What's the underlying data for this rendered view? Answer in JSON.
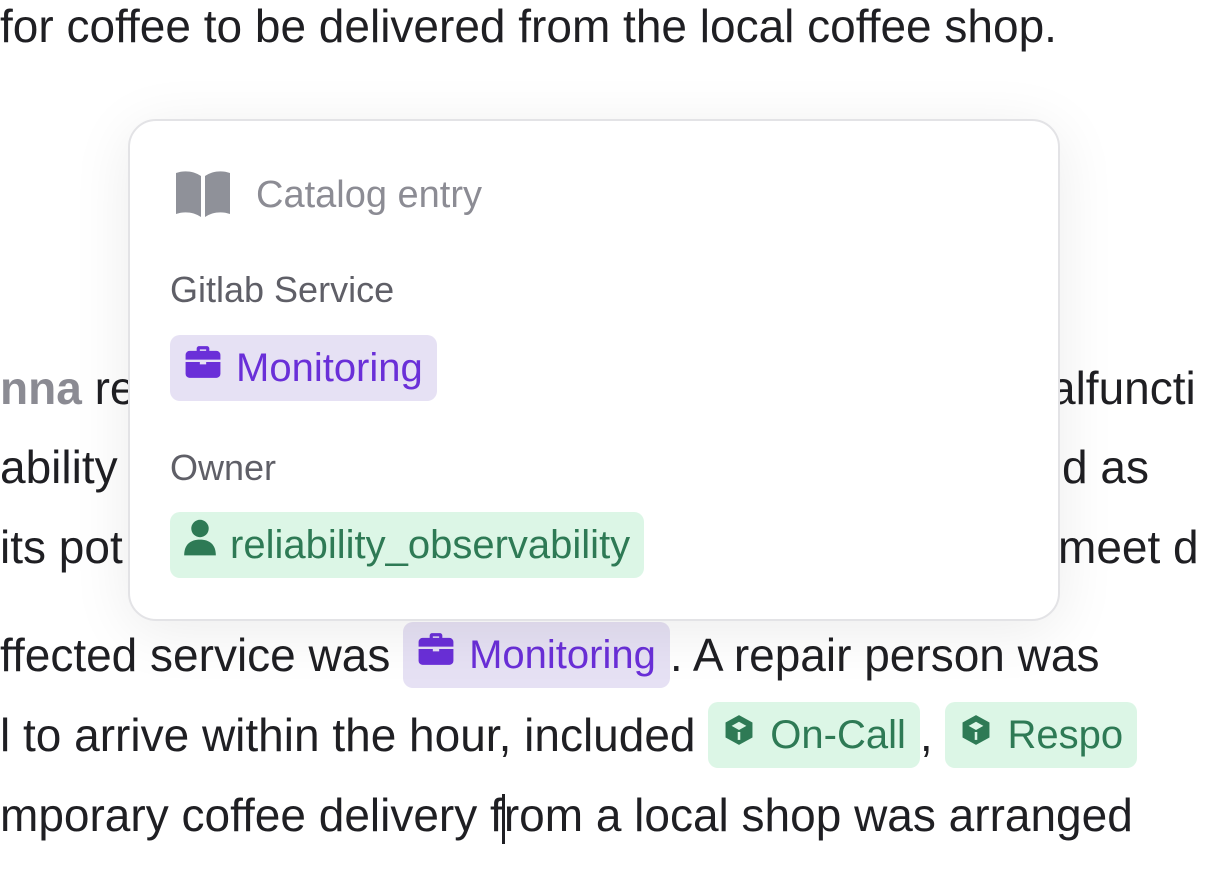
{
  "document": {
    "line1": "for coffee to be delivered from the local coffee shop.",
    "line_anna": {
      "mention": "nna",
      "before_card": "re",
      "after_card": "alfuncti"
    },
    "line_ability": {
      "before_card": " ability",
      "after_card": "d as"
    },
    "line_its": {
      "before_card": "its pot",
      "after_card": " meet d"
    },
    "line_affected": {
      "prefix": "ffected service was ",
      "chip_label": "Monitoring",
      "suffix": ". A repair person was"
    },
    "line_arrive": {
      "prefix": "l to arrive within the hour, included ",
      "chip1_label": "On-Call",
      "separator": ",",
      "chip2_label": "Respo"
    },
    "line_temporary": {
      "before_caret": "mporary coffee delivery f",
      "after_caret": "rom a local shop was arranged"
    }
  },
  "card": {
    "header_icon": "book-icon",
    "header_title": "Catalog entry",
    "service_label": "Gitlab Service",
    "service_chip": "Monitoring",
    "service_icon": "briefcase-icon",
    "owner_label": "Owner",
    "owner_chip": "reliability_observability",
    "owner_icon": "person-icon"
  },
  "colors": {
    "purple_chip_bg": "#e6e1f4",
    "purple_chip_text": "#6a2fd8",
    "green_chip_bg": "#dcf6e6",
    "green_chip_text": "#2e7a55",
    "muted_text": "#8c8c94"
  }
}
